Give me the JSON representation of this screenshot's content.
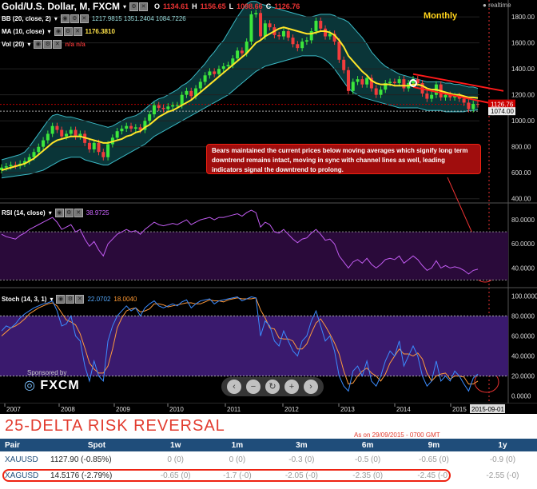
{
  "header": {
    "symbol": "Gold/U.S. Dollar, M, FXCM",
    "ohlc": {
      "o_label": "O",
      "o": "1134.61",
      "h_label": "H",
      "h": "1156.65",
      "l_label": "L",
      "l": "1098.66",
      "c_label": "C",
      "c": "1126.76"
    },
    "realtime": "realtime",
    "period": "Monthly"
  },
  "indicators": {
    "bb": {
      "label": "BB (20, close, 2)",
      "values": "1217.9815  1351.2404  1084.7226"
    },
    "ma": {
      "label": "MA (10, close)",
      "value": "1176.3810"
    },
    "vol": {
      "label": "Vol (20)",
      "value": "n/a  n/a"
    },
    "rsi": {
      "label": "RSI (14, close)",
      "value": "38.9725"
    },
    "stoch": {
      "label": "Stoch (14, 3, 1)",
      "k": "22.0702",
      "d": "18.0040"
    }
  },
  "price_axis": [
    "1800.00",
    "1600.00",
    "1400.00",
    "1200.00",
    "1126.76",
    "1074.00",
    "1000.00",
    "800.00",
    "600.00",
    "400.00"
  ],
  "rsi_axis": [
    "80.0000",
    "60.0000",
    "40.0000"
  ],
  "stoch_axis": [
    "100.0000",
    "80.0000",
    "60.0000",
    "40.0000",
    "20.0000",
    "0.0000"
  ],
  "x_axis": [
    "2007",
    "2008",
    "2009",
    "2010",
    "2011",
    "2012",
    "2013",
    "2014",
    "2015",
    "2015-09-01"
  ],
  "annotation": "Bears maintained the current prices below moving averages which signify long term downtrend remains intact, moving in sync with channel lines as well, leading indicators signal the downtrend to prolong.",
  "sponsor": {
    "label": "Sponsored by",
    "brand": "FXCM"
  },
  "nav": [
    "‹",
    "−",
    "↻",
    "+",
    "›"
  ],
  "risk_reversal": {
    "title": "25-DELTA RISK REVERSAL",
    "as_of": "As on 29/09/2015 - 0700 GMT",
    "columns": [
      "Pair",
      "Spot",
      "1w",
      "1m",
      "3m",
      "6m",
      "9m",
      "1y"
    ],
    "rows": [
      {
        "pair": "XAUUSD",
        "spot": "1127.90 (-0.85%)",
        "w1": "0 (0)",
        "m1": "0 (0)",
        "m3": "-0.3 (0)",
        "m6": "-0.5 (0)",
        "m9": "-0.65 (0)",
        "y1": "-0.9 (0)"
      },
      {
        "pair": "XAGUSD",
        "spot": "14.5176 (-2.79%)",
        "w1": "-0.65 (0)",
        "m1": "-1.7 (-0)",
        "m3": "-2.05 (-0)",
        "m6": "-2.35 (0)",
        "m9": "-2.45 (-0)",
        "y1": "-2.55 (-0)"
      }
    ]
  },
  "chart_data": {
    "type": "candlestick",
    "title": "Gold/U.S. Dollar, M, FXCM",
    "ylim": [
      380,
      1930
    ],
    "x_years": [
      "2007",
      "2008",
      "2009",
      "2010",
      "2011",
      "2012",
      "2013",
      "2014",
      "2015"
    ],
    "close": [
      640,
      650,
      660,
      655,
      670,
      690,
      720,
      760,
      800,
      850,
      900,
      960,
      930,
      880,
      900,
      930,
      880,
      900,
      830,
      780,
      830,
      760,
      720,
      820,
      870,
      920,
      940,
      960,
      940,
      950,
      930,
      1000,
      1050,
      1120,
      1100,
      1090,
      1110,
      1120,
      1120,
      1200,
      1230,
      1190,
      1250,
      1300,
      1350,
      1380,
      1360,
      1400,
      1420,
      1430,
      1480,
      1540,
      1520,
      1610,
      1820,
      1830,
      1650,
      1750,
      1720,
      1660,
      1650,
      1690,
      1640,
      1590,
      1560,
      1610,
      1620,
      1690,
      1770,
      1710,
      1650,
      1670,
      1610,
      1470,
      1390,
      1230,
      1300,
      1320,
      1280,
      1330,
      1250,
      1200,
      1240,
      1290,
      1300,
      1290,
      1320,
      1250,
      1290,
      1320,
      1290,
      1210,
      1170,
      1200,
      1280,
      1180,
      1200,
      1180,
      1190,
      1170,
      1140,
      1090,
      1130,
      1127
    ],
    "ma10": [
      620,
      630,
      640,
      650,
      660,
      670,
      690,
      710,
      740,
      770,
      800,
      830,
      850,
      860,
      870,
      880,
      880,
      880,
      870,
      860,
      850,
      840,
      830,
      830,
      840,
      850,
      860,
      880,
      890,
      910,
      920,
      950,
      970,
      1000,
      1030,
      1050,
      1070,
      1080,
      1100,
      1120,
      1140,
      1160,
      1190,
      1220,
      1250,
      1280,
      1310,
      1340,
      1370,
      1400,
      1430,
      1460,
      1490,
      1520,
      1560,
      1600,
      1620,
      1650,
      1670,
      1690,
      1710,
      1720,
      1710,
      1700,
      1690,
      1680,
      1670,
      1670,
      1680,
      1690,
      1690,
      1680,
      1660,
      1620,
      1570,
      1500,
      1460,
      1420,
      1380,
      1350,
      1310,
      1290,
      1280,
      1280,
      1280,
      1270,
      1270,
      1270,
      1270,
      1280,
      1280,
      1270,
      1250,
      1240,
      1240,
      1230,
      1220,
      1210,
      1200,
      1200,
      1190,
      1180,
      1180,
      1176
    ],
    "bb_upper": [
      700,
      710,
      720,
      730,
      740,
      760,
      800,
      850,
      900,
      950,
      1000,
      1040,
      1050,
      1040,
      1030,
      1030,
      1020,
      1010,
      1000,
      990,
      980,
      970,
      960,
      950,
      960,
      980,
      1000,
      1020,
      1030,
      1040,
      1060,
      1090,
      1120,
      1150,
      1170,
      1180,
      1200,
      1220,
      1240,
      1270,
      1290,
      1320,
      1360,
      1400,
      1440,
      1490,
      1530,
      1580,
      1620,
      1680,
      1740,
      1800,
      1850,
      1900,
      1920,
      1920,
      1900,
      1890,
      1880,
      1870,
      1860,
      1850,
      1840,
      1830,
      1820,
      1810,
      1800,
      1800,
      1810,
      1820,
      1820,
      1820,
      1810,
      1790,
      1780,
      1760,
      1720,
      1680,
      1640,
      1590,
      1530,
      1490,
      1450,
      1420,
      1400,
      1380,
      1360,
      1350,
      1340,
      1330,
      1320,
      1310,
      1300,
      1300,
      1300,
      1300,
      1290,
      1290,
      1280,
      1280,
      1270,
      1260,
      1260,
      1250
    ],
    "bb_lower": [
      560,
      565,
      570,
      575,
      580,
      585,
      590,
      600,
      610,
      620,
      640,
      660,
      680,
      700,
      710,
      720,
      720,
      720,
      700,
      690,
      680,
      670,
      660,
      660,
      680,
      700,
      720,
      740,
      760,
      780,
      800,
      820,
      850,
      880,
      900,
      920,
      940,
      960,
      980,
      1000,
      1020,
      1040,
      1060,
      1080,
      1100,
      1120,
      1140,
      1160,
      1180,
      1200,
      1230,
      1260,
      1290,
      1320,
      1350,
      1380,
      1400,
      1420,
      1430,
      1440,
      1450,
      1460,
      1470,
      1480,
      1490,
      1500,
      1500,
      1500,
      1500,
      1490,
      1470,
      1440,
      1400,
      1350,
      1300,
      1250,
      1220,
      1200,
      1180,
      1170,
      1160,
      1150,
      1140,
      1130,
      1120,
      1110,
      1100,
      1100,
      1100,
      1100,
      1100,
      1090,
      1080,
      1080,
      1080,
      1080,
      1070,
      1070,
      1070,
      1070,
      1070,
      1080,
      1080,
      1085
    ],
    "channel_upper": [
      [
        89,
        1360
      ],
      [
        103,
        1230
      ]
    ],
    "channel_lower": [
      [
        89,
        1260
      ],
      [
        103,
        1115
      ]
    ],
    "rsi": [
      68,
      66,
      65,
      64,
      67,
      69,
      72,
      74,
      76,
      78,
      80,
      82,
      78,
      72,
      74,
      76,
      70,
      72,
      64,
      58,
      62,
      55,
      50,
      60,
      64,
      68,
      70,
      72,
      70,
      71,
      68,
      72,
      75,
      78,
      76,
      75,
      76,
      77,
      76,
      78,
      80,
      76,
      78,
      80,
      81,
      82,
      80,
      82,
      82,
      83,
      84,
      85,
      83,
      86,
      88,
      86,
      74,
      78,
      76,
      70,
      69,
      72,
      68,
      64,
      61,
      64,
      65,
      69,
      72,
      68,
      63,
      64,
      60,
      50,
      45,
      40,
      45,
      47,
      44,
      48,
      43,
      40,
      43,
      47,
      48,
      47,
      50,
      44,
      47,
      50,
      47,
      42,
      38,
      40,
      46,
      40,
      42,
      40,
      41,
      40,
      38,
      35,
      38,
      39
    ],
    "stoch_k": [
      65,
      70,
      68,
      72,
      78,
      82,
      85,
      88,
      90,
      92,
      93,
      95,
      85,
      70,
      72,
      80,
      60,
      55,
      30,
      15,
      35,
      20,
      15,
      55,
      70,
      80,
      85,
      90,
      85,
      88,
      80,
      88,
      92,
      95,
      90,
      88,
      90,
      92,
      90,
      94,
      96,
      88,
      92,
      95,
      96,
      97,
      92,
      95,
      96,
      97,
      98,
      99,
      95,
      97,
      99,
      98,
      60,
      75,
      70,
      55,
      50,
      65,
      55,
      45,
      40,
      55,
      60,
      75,
      85,
      70,
      55,
      60,
      45,
      20,
      10,
      5,
      25,
      30,
      20,
      35,
      15,
      10,
      20,
      35,
      45,
      40,
      55,
      30,
      40,
      50,
      40,
      20,
      10,
      15,
      35,
      15,
      20,
      15,
      25,
      20,
      12,
      5,
      18,
      22
    ],
    "stoch_d": [
      60,
      64,
      68,
      70,
      73,
      77,
      82,
      85,
      88,
      90,
      92,
      93,
      90,
      83,
      76,
      74,
      71,
      62,
      48,
      33,
      27,
      23,
      23,
      30,
      47,
      68,
      78,
      85,
      87,
      88,
      84,
      85,
      87,
      92,
      92,
      91,
      89,
      90,
      91,
      92,
      93,
      93,
      92,
      92,
      94,
      96,
      95,
      95,
      94,
      96,
      97,
      98,
      97,
      97,
      97,
      98,
      86,
      78,
      68,
      67,
      58,
      57,
      57,
      55,
      47,
      47,
      52,
      63,
      73,
      77,
      70,
      62,
      53,
      42,
      25,
      12,
      13,
      20,
      25,
      28,
      23,
      20,
      15,
      22,
      33,
      40,
      47,
      42,
      42,
      40,
      43,
      37,
      23,
      15,
      20,
      22,
      23,
      17,
      20,
      20,
      19,
      12,
      12,
      15
    ]
  }
}
